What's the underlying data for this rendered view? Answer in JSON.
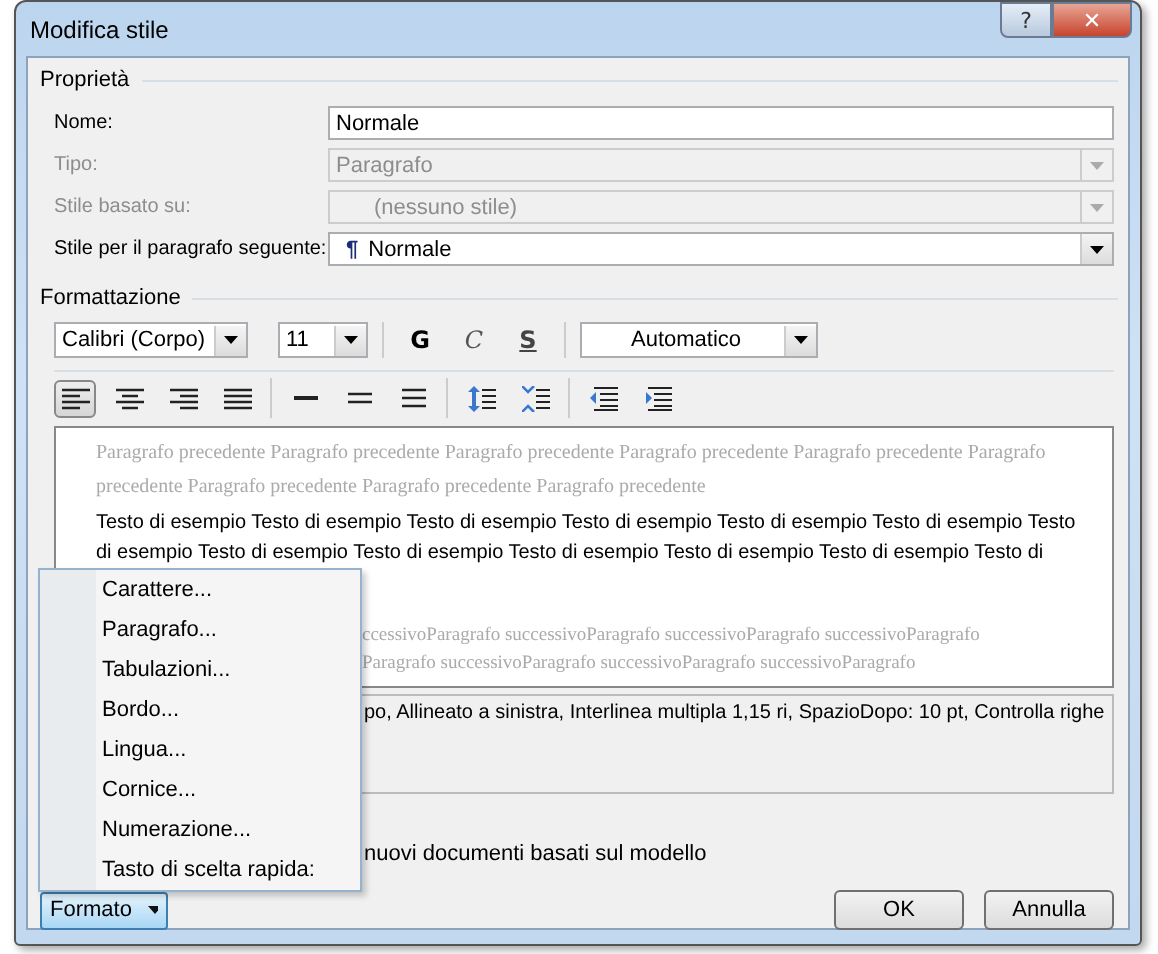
{
  "window": {
    "title": "Modifica stile",
    "buttons": [
      "?",
      "✕"
    ]
  },
  "properties": {
    "title": "Proprietà",
    "rows": [
      {
        "label": "Nome:",
        "value": "Normale",
        "kind": "text",
        "disabled": false
      },
      {
        "label": "Tipo:",
        "value": "Paragrafo",
        "kind": "combo",
        "disabled": true
      },
      {
        "label": "Stile basato su:",
        "value": "(nessuno stile)",
        "kind": "combo",
        "disabled": true
      },
      {
        "label": "Stile per il paragrafo seguente:",
        "value": "Normale",
        "kind": "combo",
        "disabled": false,
        "mark": "¶"
      }
    ]
  },
  "formatting": {
    "title": "Formattazione",
    "font": "Calibri (Corpo)",
    "size": "11",
    "style_buttons": [
      "G",
      "C",
      "S"
    ],
    "font_color_label": "Automatico",
    "alignment": [
      {
        "selected": true
      },
      {
        "selected": false
      },
      {
        "selected": false
      },
      {
        "selected": false
      }
    ]
  },
  "preview": {
    "previous_lines": [
      "Paragrafo precedente Paragrafo precedente Paragrafo precedente Paragrafo precedente Paragrafo precedente Paragrafo",
      "precedente Paragrafo precedente Paragrafo precedente Paragrafo precedente"
    ],
    "sample_lines": [
      "Testo di esempio Testo di esempio Testo di esempio Testo di esempio Testo di esempio Testo di esempio Testo",
      "di esempio Testo di esempio Testo di esempio Testo di esempio Testo di esempio Testo di esempio Testo di"
    ],
    "next_lines": [
      "ccessivoParagrafo successivoParagrafo successivoParagrafo successivoParagrafo",
      "Paragrafo successivoParagrafo successivoParagrafo successivoParagrafo"
    ]
  },
  "description": "po, Allineato a sinistra, Interlinea multipla 1,15 ri, SpazioDopo:  10 pt, Controlla righe",
  "template_option": "nuovi documenti basati sul modello",
  "format_menu": {
    "button": "Formato",
    "items": [
      "Carattere...",
      "Paragrafo...",
      "Tabulazioni...",
      "Bordo...",
      "Lingua...",
      "Cornice...",
      "Numerazione...",
      "Tasto di scelta rapida:"
    ]
  },
  "buttons": [
    "OK",
    "Annulla"
  ]
}
